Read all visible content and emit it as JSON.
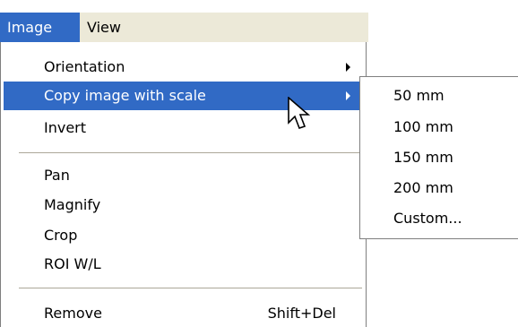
{
  "menubar": {
    "items": [
      {
        "label": "Image"
      },
      {
        "label": "View"
      }
    ]
  },
  "image_menu": {
    "items": [
      {
        "label": "Orientation"
      },
      {
        "label": "Copy image with scale"
      },
      {
        "label": "Invert"
      },
      {
        "label": "Pan"
      },
      {
        "label": "Magnify"
      },
      {
        "label": "Crop"
      },
      {
        "label": "ROI W/L"
      },
      {
        "label": "Remove",
        "shortcut": "Shift+Del"
      }
    ]
  },
  "scale_submenu": {
    "items": [
      {
        "label": "50 mm"
      },
      {
        "label": "100 mm"
      },
      {
        "label": "150 mm"
      },
      {
        "label": "200 mm"
      },
      {
        "label": "Custom..."
      }
    ]
  },
  "colors": {
    "highlight": "#316ac5",
    "menubar_bg": "#ece9d8",
    "separator": "#aca899"
  },
  "icons": {
    "cursor": "arrow-pointer-icon",
    "submenu_arrow": "triangle-right-icon"
  }
}
